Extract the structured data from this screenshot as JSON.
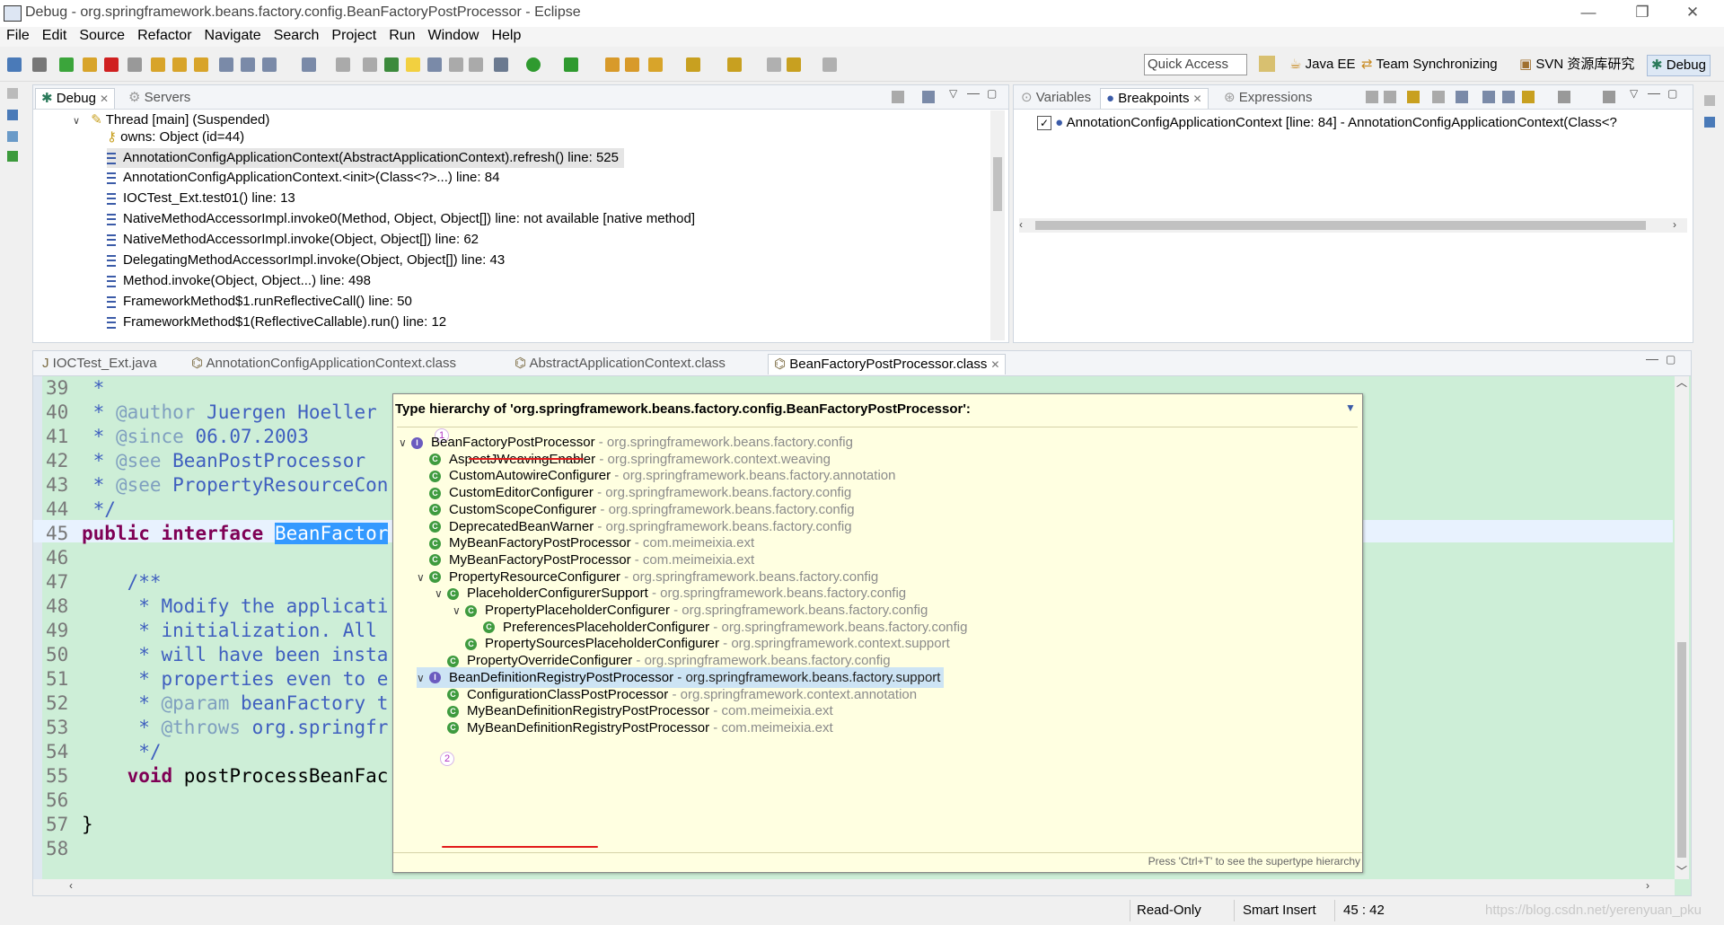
{
  "window": {
    "title": "Debug - org.springframework.beans.factory.config.BeanFactoryPostProcessor - Eclipse",
    "controls": {
      "minimize": "—",
      "restore": "❐",
      "close": "✕"
    }
  },
  "menu": [
    "File",
    "Edit",
    "Source",
    "Refactor",
    "Navigate",
    "Search",
    "Project",
    "Run",
    "Window",
    "Help"
  ],
  "toolbar": {
    "quick_access_placeholder": "Quick Access",
    "perspectives": [
      "Java EE",
      "Team Synchronizing",
      "SVN 资源库研究",
      "Debug"
    ]
  },
  "debug_view": {
    "tabs": [
      {
        "label": "Debug",
        "closable": "✕"
      },
      {
        "label": "Servers"
      }
    ],
    "thread": "Thread [main] (Suspended)",
    "owns": "owns: Object  (id=44)",
    "frames": [
      "AnnotationConfigApplicationContext(AbstractApplicationContext).refresh() line: 525",
      "AnnotationConfigApplicationContext.<init>(Class<?>...) line: 84",
      "IOCTest_Ext.test01() line: 13",
      "NativeMethodAccessorImpl.invoke0(Method, Object, Object[]) line: not available [native method]",
      "NativeMethodAccessorImpl.invoke(Object, Object[]) line: 62",
      "DelegatingMethodAccessorImpl.invoke(Object, Object[]) line: 43",
      "Method.invoke(Object, Object...) line: 498",
      "FrameworkMethod$1.runReflectiveCall() line: 50",
      "FrameworkMethod$1(ReflectiveCallable).run() line: 12"
    ]
  },
  "variables_view": {
    "tabs": [
      {
        "label": "Variables"
      },
      {
        "label": "Breakpoints",
        "closable": "✕"
      },
      {
        "label": "Expressions"
      }
    ],
    "breakpoint": "AnnotationConfigApplicationContext [line: 84] - AnnotationConfigApplicationContext(Class<?"
  },
  "editor": {
    "tabs": [
      {
        "label": "IOCTest_Ext.java"
      },
      {
        "label": "AnnotationConfigApplicationContext.class"
      },
      {
        "label": "AbstractApplicationContext.class"
      },
      {
        "label": "BeanFactoryPostProcessor.class",
        "closable": "✕"
      }
    ],
    "lines": [
      {
        "n": "39",
        "text": " *"
      },
      {
        "n": "40",
        "text": " * @author Juergen Hoeller"
      },
      {
        "n": "41",
        "text": " * @since 06.07.2003"
      },
      {
        "n": "42",
        "text": " * @see BeanPostProcessor"
      },
      {
        "n": "43",
        "text": " * @see PropertyResourceCon"
      },
      {
        "n": "44",
        "text": " */"
      },
      {
        "n": "45",
        "text": "public interface BeanFactor"
      },
      {
        "n": "46",
        "text": ""
      },
      {
        "n": "47",
        "text": "    /**"
      },
      {
        "n": "48",
        "text": "     * Modify the applicati"
      },
      {
        "n": "49",
        "text": "     * initialization. All"
      },
      {
        "n": "50",
        "text": "     * will have been insta"
      },
      {
        "n": "51",
        "text": "     * properties even to e"
      },
      {
        "n": "52",
        "text": "     * @param beanFactory t"
      },
      {
        "n": "53",
        "text": "     * @throws org.springfr"
      },
      {
        "n": "54",
        "text": "     */"
      },
      {
        "n": "55",
        "text": "    void postProcessBeanFac"
      },
      {
        "n": "56",
        "text": ""
      },
      {
        "n": "57",
        "text": "}"
      },
      {
        "n": "58",
        "text": ""
      }
    ]
  },
  "hierarchy_popup": {
    "title": "Type hierarchy of 'org.springframework.beans.factory.config.BeanFactoryPostProcessor':",
    "footer": "Press 'Ctrl+T' to see the supertype hierarchy",
    "badges": [
      "1",
      "2"
    ],
    "rows": [
      {
        "name": "BeanFactoryPostProcessor",
        "pkg": "org.springframework.beans.factory.config",
        "kind": "interface",
        "depth": 0,
        "twisty": "v"
      },
      {
        "name": "AspectJWeavingEnabler",
        "pkg": "org.springframework.context.weaving",
        "kind": "class",
        "depth": 1
      },
      {
        "name": "CustomAutowireConfigurer",
        "pkg": "org.springframework.beans.factory.annotation",
        "kind": "class",
        "depth": 1
      },
      {
        "name": "CustomEditorConfigurer",
        "pkg": "org.springframework.beans.factory.config",
        "kind": "class",
        "depth": 1
      },
      {
        "name": "CustomScopeConfigurer",
        "pkg": "org.springframework.beans.factory.config",
        "kind": "class",
        "depth": 1
      },
      {
        "name": "DeprecatedBeanWarner",
        "pkg": "org.springframework.beans.factory.config",
        "kind": "class",
        "depth": 1
      },
      {
        "name": "MyBeanFactoryPostProcessor",
        "pkg": "com.meimeixia.ext",
        "kind": "class",
        "depth": 1
      },
      {
        "name": "MyBeanFactoryPostProcessor",
        "pkg": "com.meimeixia.ext",
        "kind": "class",
        "depth": 1
      },
      {
        "name": "PropertyResourceConfigurer",
        "pkg": "org.springframework.beans.factory.config",
        "kind": "abstract",
        "depth": 1,
        "twisty": "v"
      },
      {
        "name": "PlaceholderConfigurerSupport",
        "pkg": "org.springframework.beans.factory.config",
        "kind": "abstract",
        "depth": 2,
        "twisty": "v"
      },
      {
        "name": "PropertyPlaceholderConfigurer",
        "pkg": "org.springframework.beans.factory.config",
        "kind": "class",
        "depth": 3,
        "twisty": "v"
      },
      {
        "name": "PreferencesPlaceholderConfigurer",
        "pkg": "org.springframework.beans.factory.config",
        "kind": "class",
        "depth": 4
      },
      {
        "name": "PropertySourcesPlaceholderConfigurer",
        "pkg": "org.springframework.context.support",
        "kind": "class",
        "depth": 3
      },
      {
        "name": "PropertyOverrideConfigurer",
        "pkg": "org.springframework.beans.factory.config",
        "kind": "class",
        "depth": 2
      },
      {
        "name": "BeanDefinitionRegistryPostProcessor",
        "pkg": "org.springframework.beans.factory.support",
        "kind": "interface",
        "depth": 1,
        "twisty": "v",
        "selected": true
      },
      {
        "name": "ConfigurationClassPostProcessor",
        "pkg": "org.springframework.context.annotation",
        "kind": "class",
        "depth": 2
      },
      {
        "name": "MyBeanDefinitionRegistryPostProcessor",
        "pkg": "com.meimeixia.ext",
        "kind": "class",
        "depth": 2
      },
      {
        "name": "MyBeanDefinitionRegistryPostProcessor",
        "pkg": "com.meimeixia.ext",
        "kind": "class",
        "depth": 2
      }
    ]
  },
  "status": {
    "mode": "Read-Only",
    "insert": "Smart Insert",
    "position": "45 : 42"
  },
  "watermark": "https://blog.csdn.net/yerenyuan_pku",
  "colors": {
    "editor_bg": "#cdeed7",
    "popup_bg": "#ffffe1",
    "selection": "#3399ff",
    "annotation_red": "#e21b1b"
  }
}
